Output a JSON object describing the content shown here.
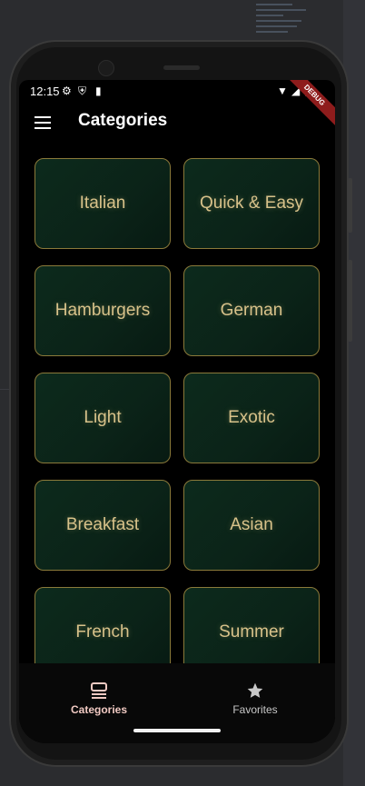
{
  "status_bar": {
    "time": "12:15"
  },
  "debug_banner": "DEBUG",
  "app_bar": {
    "title": "Categories"
  },
  "categories": [
    {
      "label": "Italian"
    },
    {
      "label": "Quick & Easy"
    },
    {
      "label": "Hamburgers"
    },
    {
      "label": "German"
    },
    {
      "label": "Light"
    },
    {
      "label": "Exotic"
    },
    {
      "label": "Breakfast"
    },
    {
      "label": "Asian"
    },
    {
      "label": "French"
    },
    {
      "label": "Summer"
    }
  ],
  "bottom_nav": {
    "items": [
      {
        "label": "Categories",
        "icon": "categories-icon",
        "active": true
      },
      {
        "label": "Favorites",
        "icon": "star-icon",
        "active": false
      }
    ]
  },
  "colors": {
    "tile_text": "#d8c28a",
    "tile_border": "#8b7a3a",
    "tile_bg": "#0b2318",
    "active_nav": "#f0c9c2",
    "debug_banner": "#8e1c1c"
  }
}
